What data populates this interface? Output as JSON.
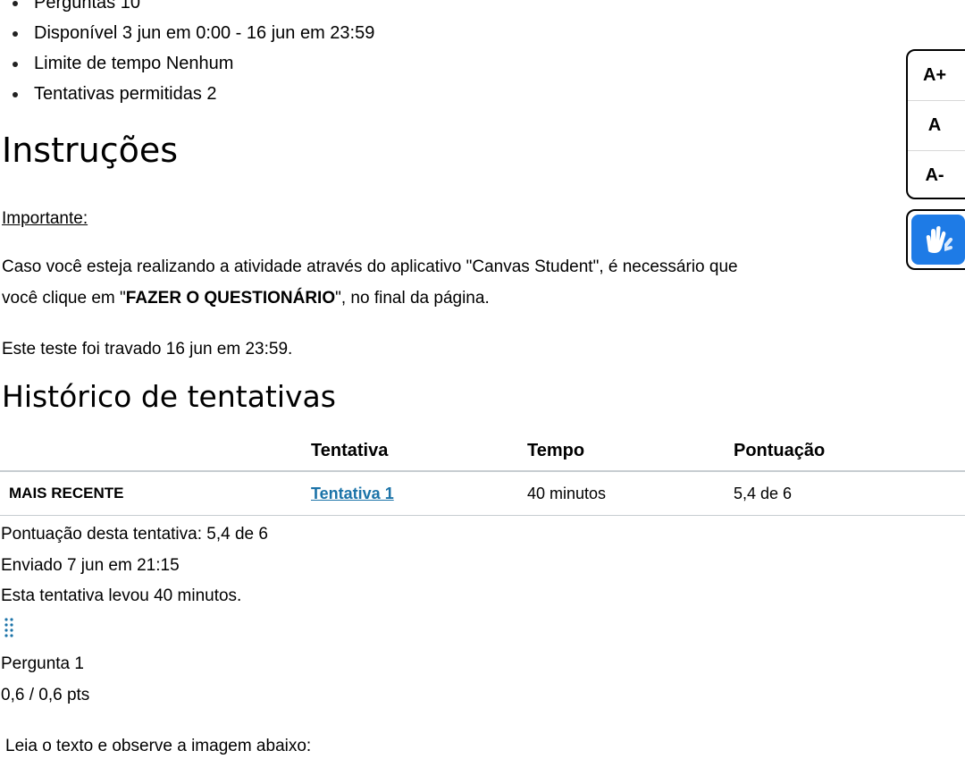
{
  "quiz_details": [
    "Perguntas 10",
    "Disponível 3 jun em 0:00 - 16 jun em 23:59",
    "Limite de tempo Nenhum",
    "Tentativas permitidas 2"
  ],
  "instructions": {
    "heading": "Instruções",
    "important": "Importante:",
    "line1": "Caso você esteja realizando a atividade através do aplicativo \"Canvas Student\", é necessário que",
    "line2_prefix": "você clique em \"",
    "line2_bold": "FAZER O QUESTIONÁRIO",
    "line2_suffix": "\", no final da página.",
    "locked": "Este teste foi travado 16 jun em 23:59."
  },
  "history": {
    "heading": "Histórico de tentativas",
    "columns": [
      "",
      "Tentativa",
      "Tempo",
      "Pontuação"
    ],
    "rows": [
      {
        "label": "MAIS RECENTE",
        "attempt": "Tentativa 1",
        "time": "40 minutos",
        "score": "5,4 de 6"
      }
    ]
  },
  "summary": {
    "score": "Pontuação desta tentativa: 5,4 de 6",
    "submitted": "Enviado 7 jun em 21:15",
    "duration": "Esta tentativa levou 40 minutos."
  },
  "question": {
    "drag_icon": "drag-handle-icon",
    "title": "Pergunta 1",
    "points": "0,6 / 0,6 pts",
    "text": "Leia o texto e observe a imagem abaixo:"
  },
  "font_widget": {
    "increase": "A+",
    "normal": "A",
    "decrease": "A-"
  },
  "accessibility": {
    "icon": "sign-language-hands-icon",
    "accent": "#1e7be6"
  },
  "colors": {
    "link": "#1b73a8"
  }
}
